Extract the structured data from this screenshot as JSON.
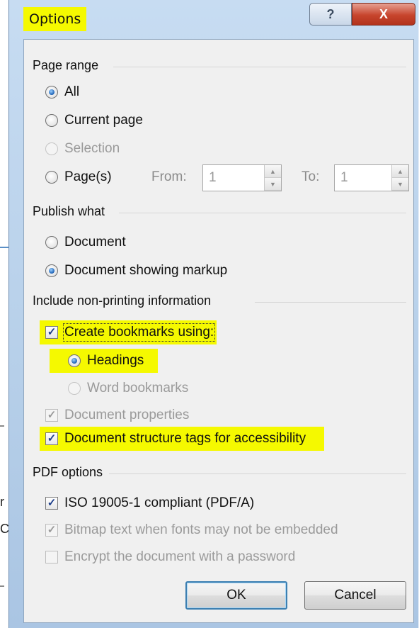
{
  "window": {
    "title": "Options",
    "help_label": "?",
    "close_label": "X"
  },
  "background": {
    "frag1": "r",
    "frag2": "C"
  },
  "page_range": {
    "label": "Page range",
    "all": "All",
    "current_page": "Current page",
    "selection": "Selection",
    "pages": "Page(s)",
    "from_label": "From:",
    "from_value": "1",
    "to_label": "To:",
    "to_value": "1",
    "selected": "All"
  },
  "publish_what": {
    "label": "Publish what",
    "document": "Document",
    "document_markup": "Document showing markup",
    "selected": "Document showing markup"
  },
  "non_printing": {
    "label": "Include non-printing information",
    "create_bookmarks": "Create bookmarks using:",
    "headings": "Headings",
    "word_bookmarks": "Word bookmarks",
    "document_properties": "Document properties",
    "structure_tags": "Document structure tags for accessibility"
  },
  "pdf_options": {
    "label": "PDF options",
    "iso": "ISO 19005-1 compliant (PDF/A)",
    "bitmap_text": "Bitmap text when fonts may not be embedded",
    "encrypt": "Encrypt the document with a password"
  },
  "buttons": {
    "ok": "OK",
    "cancel": "Cancel"
  },
  "icons": {
    "check_mark": "✓",
    "spin_up": "▲",
    "spin_down": "▼"
  },
  "colors": {
    "highlight": "#f5f900",
    "close_red": "#c7452d",
    "radio_blue": "#1a5fb4"
  }
}
